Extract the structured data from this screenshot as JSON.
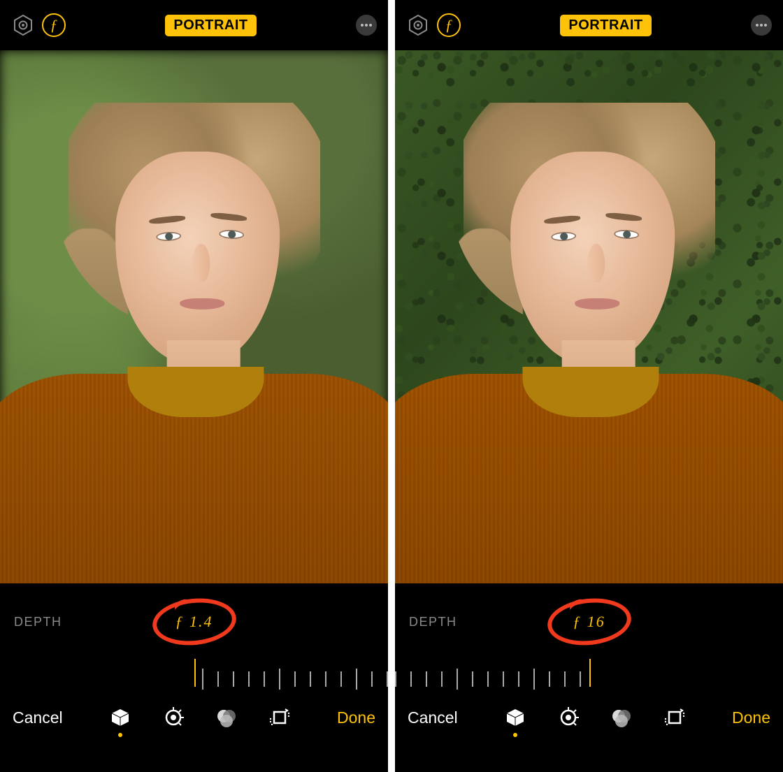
{
  "panes": [
    {
      "header": {
        "mode_label": "PORTRAIT",
        "f_icon": "ƒ"
      },
      "depth": {
        "label": "DEPTH",
        "value": "ƒ 1.4",
        "slider_alignment": "right"
      },
      "toolbar": {
        "cancel": "Cancel",
        "done": "Done"
      },
      "photo": {
        "background_blur": true
      }
    },
    {
      "header": {
        "mode_label": "PORTRAIT",
        "f_icon": "ƒ"
      },
      "depth": {
        "label": "DEPTH",
        "value": "ƒ 16",
        "slider_alignment": "left"
      },
      "toolbar": {
        "cancel": "Cancel",
        "done": "Done"
      },
      "photo": {
        "background_blur": false
      }
    }
  ],
  "icons": {
    "lighting": "lighting-hex-icon",
    "aperture": "f-stop-icon",
    "more": "ellipsis-icon",
    "portrait_tab": "cube-icon",
    "adjust_tab": "adjust-dial-icon",
    "filters_tab": "filters-circles-icon",
    "crop_tab": "crop-rotate-icon"
  },
  "annotation_color": "#f0391d",
  "accent_color": "#FEC309"
}
